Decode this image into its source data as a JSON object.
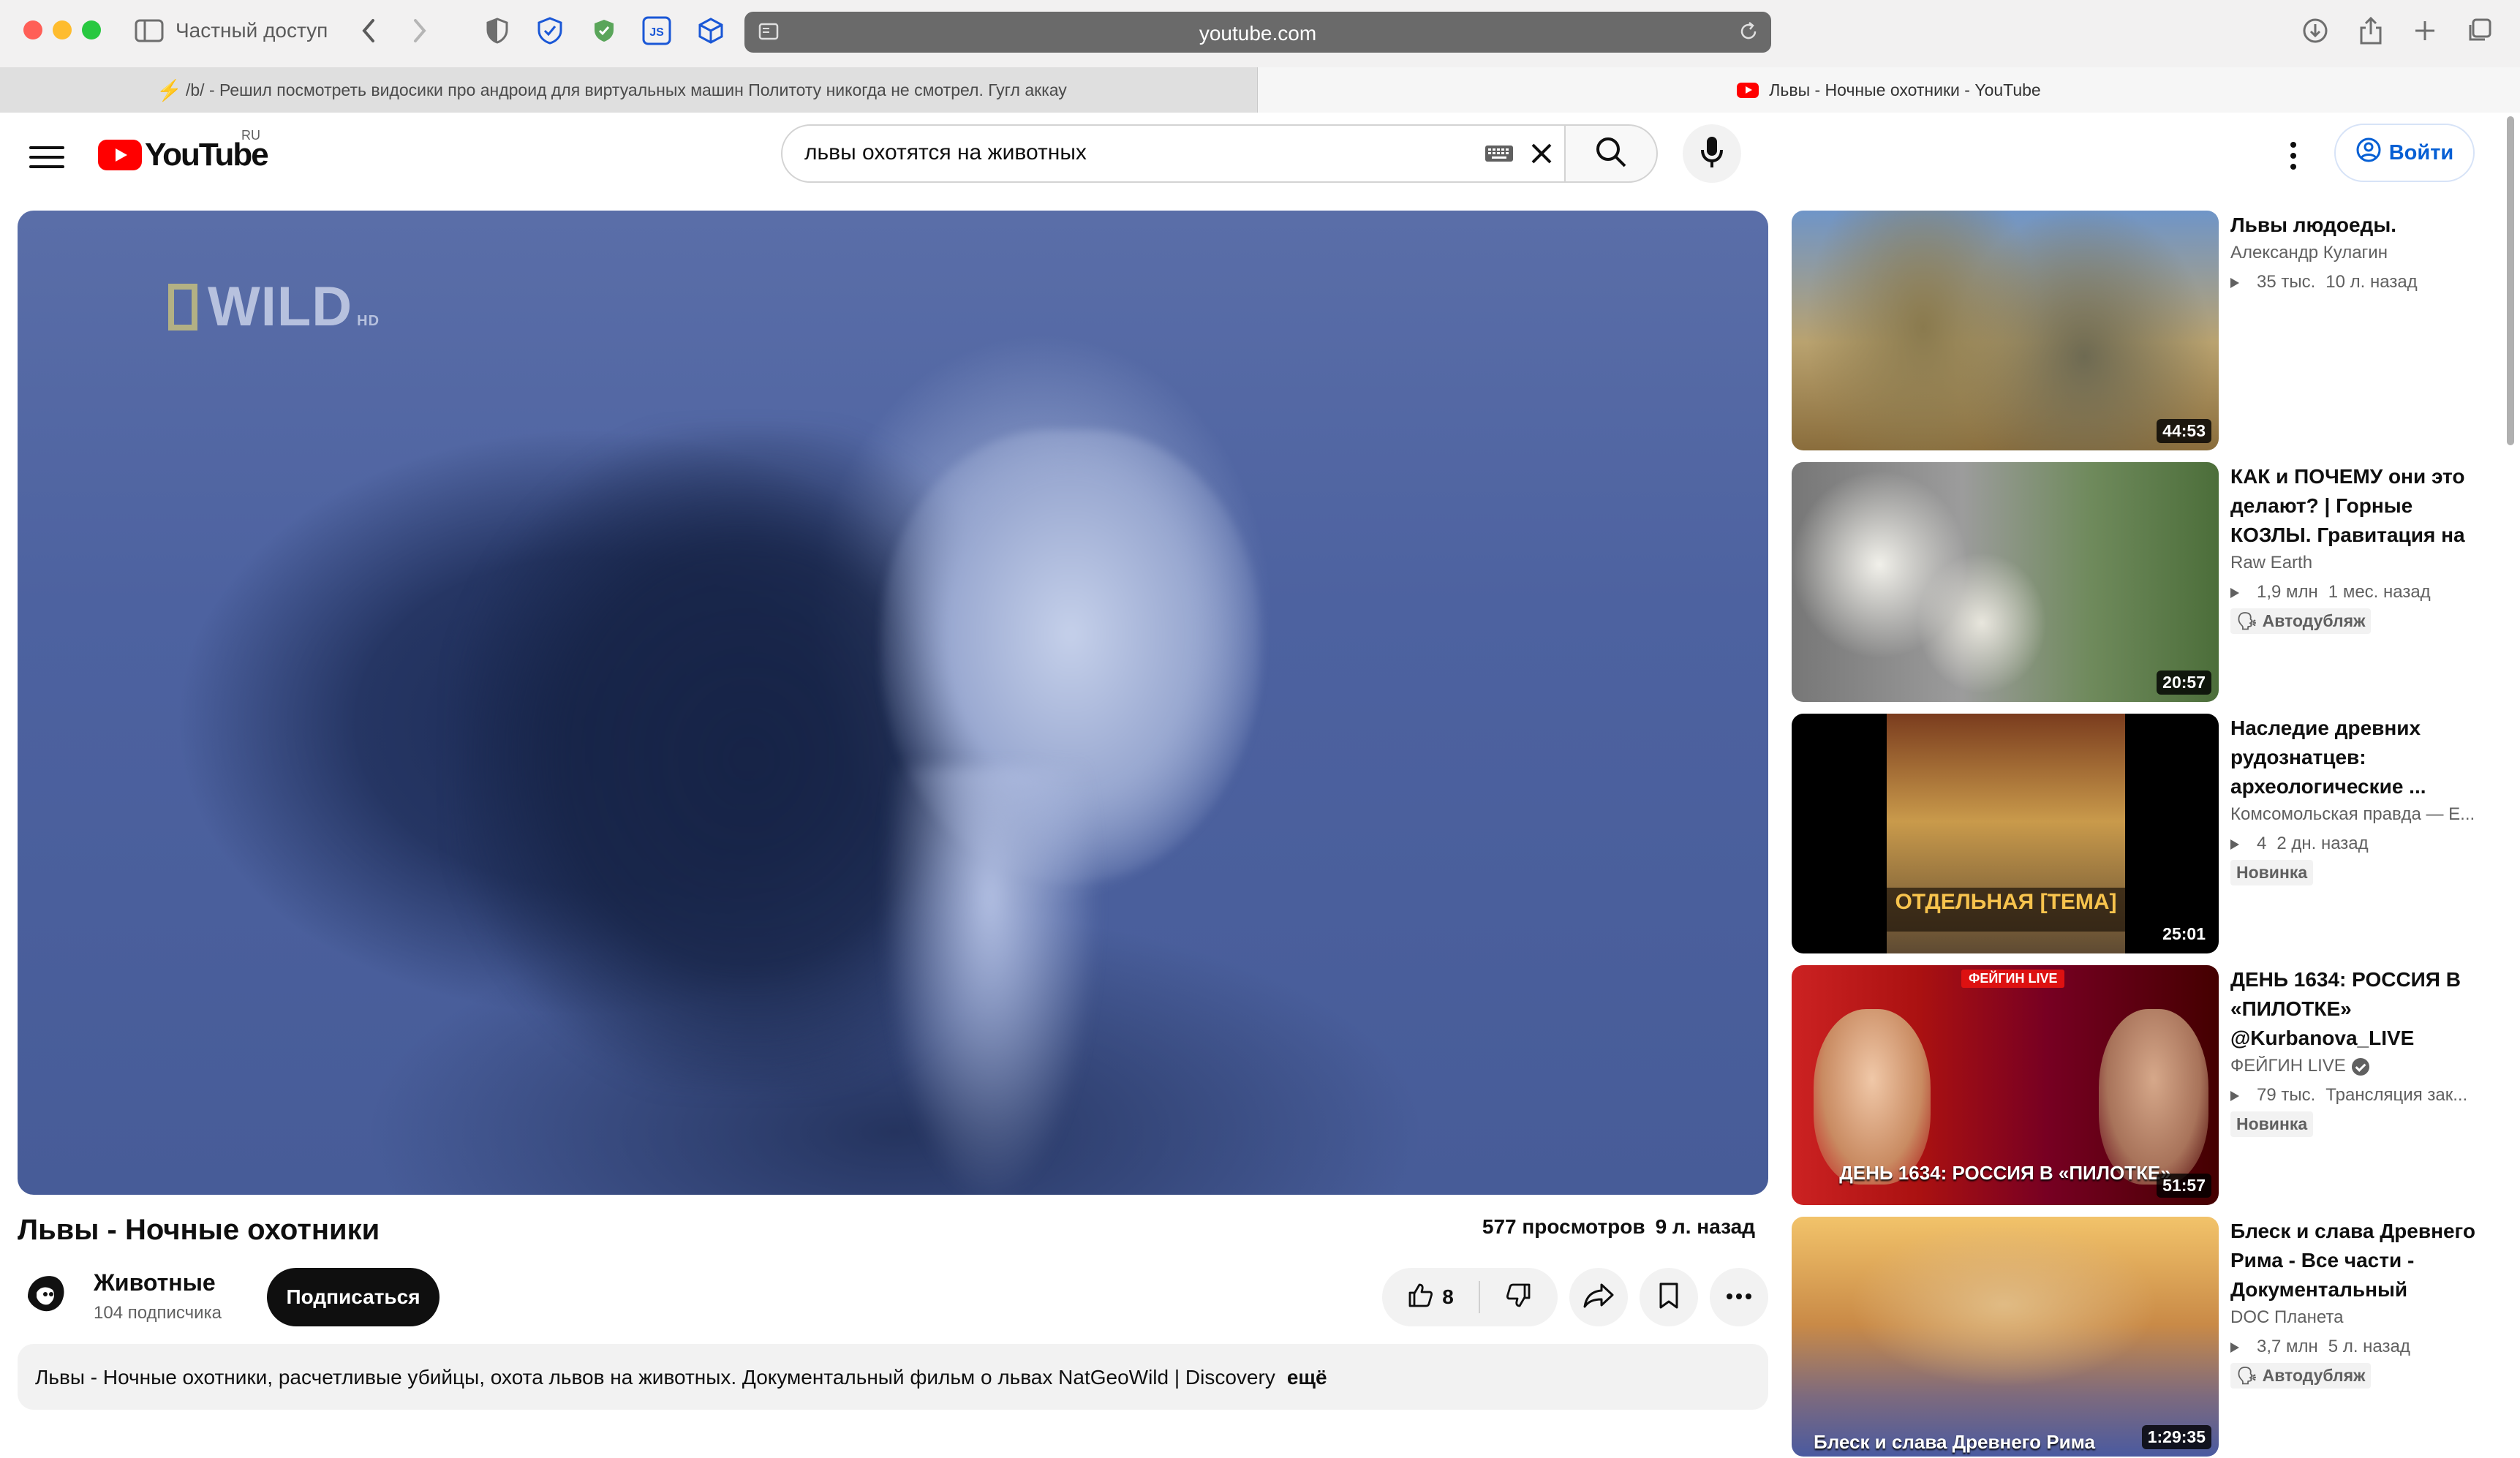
{
  "browser": {
    "private_label": "Частный доступ",
    "url": "youtube.com"
  },
  "tabs": [
    {
      "label": "/b/ - Решил посмотреть видосики про андроид для виртуальных машин Политоту никогда не смотрел. Гугл аккау"
    },
    {
      "label": "Львы - Ночные охотники - YouTube"
    }
  ],
  "header": {
    "logo_text": "YouTube",
    "region": "RU",
    "search_value": "львы охотятся на животных",
    "signin_label": "Войти"
  },
  "player": {
    "watermark": "WILD",
    "watermark_suffix": "HD"
  },
  "video": {
    "title": "Львы - Ночные охотники",
    "views": "577 просмотров",
    "age": "9 л. назад",
    "channel_name": "Животные",
    "subscribers": "104 подписчика",
    "subscribe_label": "Подписаться",
    "likes": "8",
    "description": "Львы - Ночные охотники, расчетливые убийцы, охота львов на животных. Документальный фильм о львах NatGeoWild | Discovery",
    "more_label": "ещё"
  },
  "recommendations": [
    {
      "title": "Львы людоеды.",
      "channel": "Александр Кулагин",
      "views": "35 тыс.",
      "age": "10 л. назад",
      "duration": "44:53"
    },
    {
      "title": "КАК и ПОЧЕМУ они это делают? | Горные КОЗЛЫ. Гравитация на ...",
      "channel": "Raw Earth",
      "views": "1,9 млн",
      "age": "1 мес. назад",
      "duration": "20:57",
      "badge": "Автодубляж"
    },
    {
      "title": "Наследие древних рудознатцев: археологические ...",
      "channel": "Комсомольская правда — Е...",
      "views": "4",
      "age": "2 дн. назад",
      "duration": "25:01",
      "badge": "Новинка",
      "thumb_text": "ОТДЕЛЬНАЯ [ТЕМА]"
    },
    {
      "title": "ДЕНЬ 1634: РОССИЯ В «ПИЛОТКЕ» @Kurbanova_LIVE",
      "channel": "ФЕЙГИН LIVE",
      "views": "79 тыс.",
      "age": "Трансляция зак...",
      "duration": "51:57",
      "badge": "Новинка",
      "thumb_tag": "ФЕЙГИН LIVE",
      "thumb_text": "ДЕНЬ 1634: РОССИЯ В «ПИЛОТКЕ»"
    },
    {
      "title": "Блеск и слава Древнего Рима - Все части - Документальный филь...",
      "channel": "DOC Планета",
      "views": "3,7 млн",
      "age": "5 л. назад",
      "duration": "1:29:35",
      "badge": "Автодубляж",
      "thumb_text": "Блеск и слава Древнего Рима"
    }
  ]
}
